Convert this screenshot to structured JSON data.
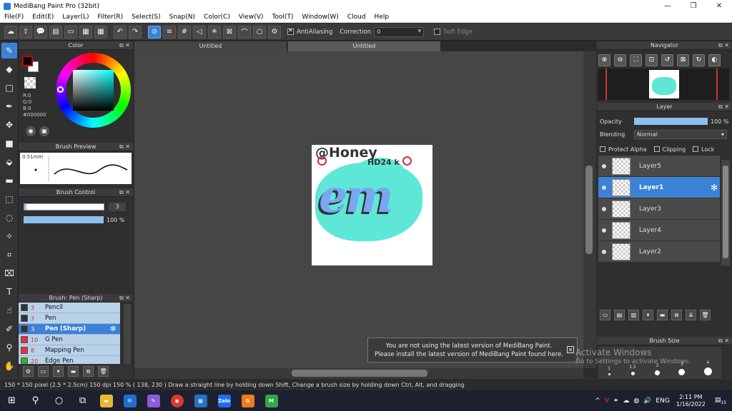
{
  "window": {
    "title": "MediBang Paint Pro (32bit)",
    "minimize": "—",
    "restore": "❐",
    "close": "✕"
  },
  "menu": [
    "File(F)",
    "Edit(E)",
    "Layer(L)",
    "Filter(R)",
    "Select(S)",
    "Snap(N)",
    "Color(C)",
    "View(V)",
    "Tool(T)",
    "Window(W)",
    "Cloud",
    "Help"
  ],
  "toolbar": {
    "antialiasing_label": "AntiAliasing",
    "correction_label": "Correction",
    "correction_value": "0",
    "soft_edge_label": "Soft Edge"
  },
  "color_panel": {
    "title": "Color",
    "rgb": [
      "R:0",
      "G:0",
      "B:0",
      "#000000"
    ],
    "fg_color": "#000000",
    "bg_color": "#ffffff"
  },
  "brush_preview": {
    "title": "Brush Preview",
    "size_label": "0.51mm"
  },
  "brush_control": {
    "title": "Brush Control",
    "size_value": "3",
    "size_fraction": 1.0,
    "opacity_value": "100 %"
  },
  "brush_list": {
    "title": "Brush: Pen (Sharp)",
    "items": [
      {
        "num": "3",
        "name": "Pencil",
        "swatch": "#333333"
      },
      {
        "num": "3",
        "name": "Pen",
        "swatch": "#333333"
      },
      {
        "num": "3",
        "name": "Pen (Sharp)",
        "swatch": "#333333",
        "active": true
      },
      {
        "num": "10",
        "name": "G Pen",
        "swatch": "#e83030"
      },
      {
        "num": "8",
        "name": "Mapping Pen",
        "swatch": "#e83030"
      },
      {
        "num": "20",
        "name": "Edge Pen",
        "swatch": "#30b030"
      }
    ]
  },
  "tabs": [
    "Untitled",
    "Untitled"
  ],
  "artwork": {
    "handle": "@Honey",
    "sub": "HD24",
    "sub2": "k",
    "script": "em"
  },
  "toast": {
    "line1": "You are not using the latest version of MediBang Paint.",
    "line2": "Please install the latest version of MediBang Paint found here."
  },
  "navigator": {
    "title": "Navigator"
  },
  "layer_panel": {
    "title": "Layer",
    "opacity_label": "Opacity",
    "opacity_value": "100 %",
    "opacity_fraction": 1.0,
    "blending_label": "Blending",
    "blending_value": "Normal",
    "protect_alpha": "Protect Alpha",
    "clipping": "Clipping",
    "lock": "Lock",
    "layers": [
      {
        "name": "Layer5",
        "active": false
      },
      {
        "name": "Layer1",
        "active": true
      },
      {
        "name": "Layer3",
        "active": false
      },
      {
        "name": "Layer4",
        "active": false
      },
      {
        "name": "Layer2",
        "active": false
      }
    ]
  },
  "brush_size": {
    "title": "Brush Size",
    "sizes": [
      "1",
      "1.5",
      "2",
      "3",
      "4"
    ]
  },
  "watermark": {
    "line1": "Activate Windows",
    "line2": "Go to Settings to activate Windows."
  },
  "statusbar": {
    "text": "150 * 150 pixel  (2.5 * 2.5cm)  150 dpi  150 %  ( 138, 230 )  Draw a straight line by holding down Shift, Change a brush size by holding down Ctrl, Alt, and dragging"
  },
  "taskbar": {
    "lang": "ENG",
    "time": "2:11 PM",
    "date": "1/16/2022",
    "notifications": "15",
    "apps": [
      {
        "name": "zalo",
        "label": "Zalo",
        "color": "#1e6ff0"
      },
      {
        "name": "g-app",
        "label": "G",
        "color": "#f07a18"
      },
      {
        "name": "medibang",
        "label": "M",
        "color": "#2fa84a"
      }
    ]
  }
}
